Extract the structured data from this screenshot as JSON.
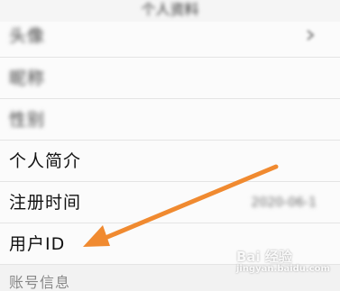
{
  "header": {
    "title": "个人资料"
  },
  "rows": [
    {
      "label": "头像",
      "value": "",
      "blurred": true
    },
    {
      "label": "昵称",
      "value": "",
      "blurred": true
    },
    {
      "label": "性别",
      "value": "",
      "blurred": true
    },
    {
      "label": "个人简介",
      "value": "",
      "blurred": false
    },
    {
      "label": "注册时间",
      "value": "2020-06-1",
      "blurred": false
    },
    {
      "label": "用户ID",
      "value": "",
      "blurred": false
    }
  ],
  "section": {
    "label": "账号信息"
  },
  "annotation": {
    "arrow_color": "#f08a30"
  },
  "watermark": {
    "text": "Bai 经验",
    "sub": "jingyan.baidu.com"
  }
}
